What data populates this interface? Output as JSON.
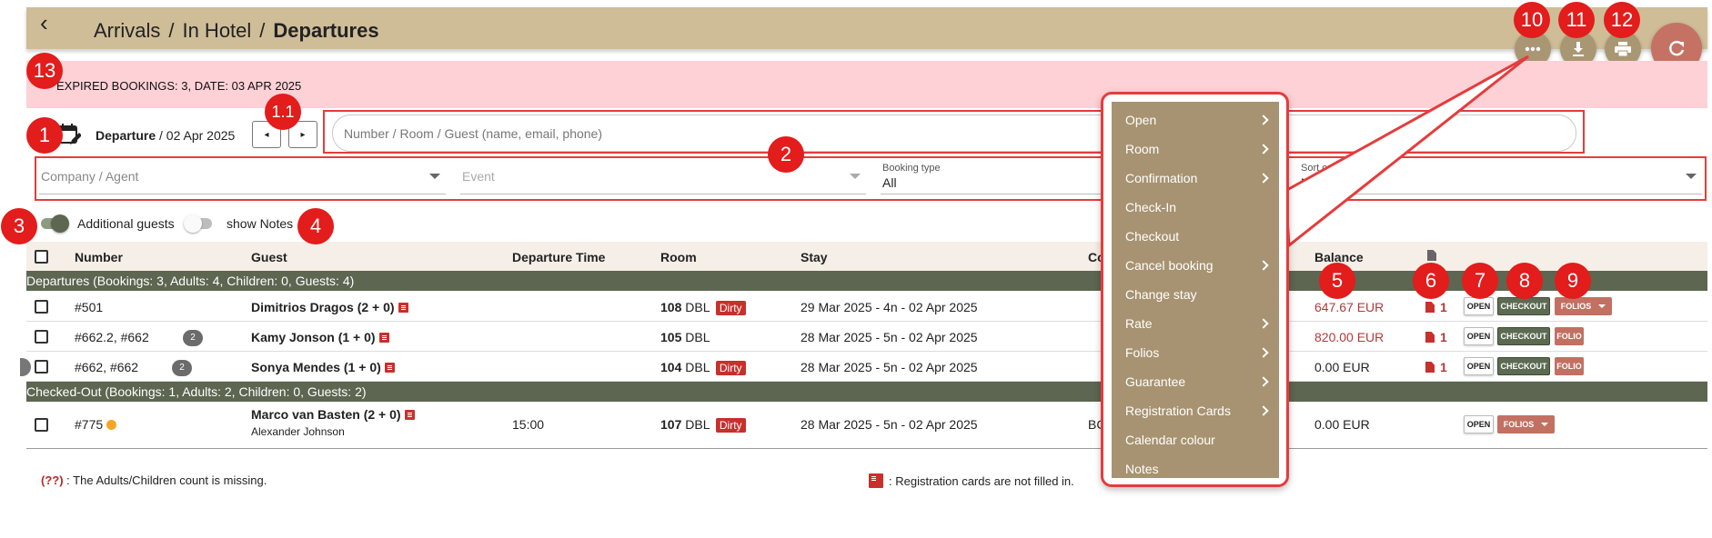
{
  "header": {
    "crumbs": [
      "Arrivals",
      "In Hotel",
      "Departures"
    ],
    "separator": "/"
  },
  "icons": {
    "back": "arrow-left-icon",
    "more": "more-horizontal-icon",
    "download": "download-icon",
    "print": "print-icon",
    "refresh": "refresh-icon",
    "calendar": "calendar-edit-icon"
  },
  "banner": {
    "text": "EXPIRED BOOKINGS: 3, DATE: 03 APR 2025"
  },
  "annotations": {
    "a1": "1",
    "a11": "1.1",
    "a2": "2",
    "a3": "3",
    "a4": "4",
    "a5": "5",
    "a6": "6",
    "a7": "7",
    "a8": "8",
    "a9": "9",
    "a10": "10",
    "a11b": "11",
    "a12": "12",
    "a13": "13"
  },
  "toolbar": {
    "date_bold": "Departure",
    "date_rest": " / 02 Apr 2025",
    "prev": "◂",
    "next": "▸",
    "search_placeholder": "Number / Room / Guest (name, email, phone)"
  },
  "filters": {
    "company": "Company / Agent",
    "event": "Event",
    "booking_type_label": "Booking type",
    "booking_type_value": "All",
    "sort_order_label": "Sort order",
    "sort_order_value": "Name"
  },
  "toggles": {
    "additional_guests": "Additional guests",
    "show_notes": "show Notes"
  },
  "table": {
    "headers": {
      "number": "Number",
      "guest": "Guest",
      "departure_time": "Departure Time",
      "room": "Room",
      "stay": "Stay",
      "company": "Co",
      "balance": "Balance"
    },
    "groups": [
      "Departures (Bookings: 3, Adults: 4, Children: 0, Guests: 4)",
      "Checked-Out (Bookings: 1, Adults: 2, Children: 0, Guests: 2)"
    ],
    "rows": [
      {
        "number": "#501",
        "badge": "",
        "guest": "Dimitrios Dragos (2 + 0)",
        "guest2": "",
        "time": "",
        "room_no": "108",
        "room_type": "DBL",
        "dirty": "Dirty",
        "stay": "29 Mar 2025 - 4n - 02 Apr 2025",
        "company": "",
        "balance": "647.67 EUR",
        "docs": "1"
      },
      {
        "number": "#662.2, #662",
        "badge": "2",
        "guest": "Kamy Jonson (1 + 0)",
        "guest2": "",
        "time": "",
        "room_no": "105",
        "room_type": "DBL",
        "dirty": "",
        "stay": "28 Mar 2025 - 5n - 02 Apr 2025",
        "company": "",
        "balance": "820.00 EUR",
        "docs": "1"
      },
      {
        "number": "#662, #662",
        "badge": "2",
        "guest": "Sonya Mendes (1 + 0)",
        "guest2": "",
        "time": "",
        "room_no": "104",
        "room_type": "DBL",
        "dirty": "Dirty",
        "stay": "28 Mar 2025 - 5n - 02 Apr 2025",
        "company": "",
        "balance": "0.00 EUR",
        "docs": "1"
      },
      {
        "number": "#775",
        "badge": "",
        "guest": "Marco van Basten (2 + 0)",
        "guest2": "Alexander Johnson",
        "time": "15:00",
        "room_no": "107",
        "room_type": "DBL",
        "dirty": "Dirty",
        "stay": "28 Mar 2025 - 5n - 02 Apr 2025",
        "company": "BC",
        "balance": "0.00 EUR",
        "docs": ""
      }
    ]
  },
  "buttons": {
    "open": "OPEN",
    "checkout": "CHECKOUT",
    "folios": "FOLIOS",
    "folio": "FOLIO"
  },
  "legend": {
    "missing_code": "(??)",
    "missing_text": " : The Adults/Children count is missing.",
    "reg_text": ": Registration cards are not filled in."
  },
  "context_menu": {
    "items": [
      {
        "label": "Open",
        "submenu": true
      },
      {
        "label": "Room",
        "submenu": true
      },
      {
        "label": "Confirmation",
        "submenu": true
      },
      {
        "label": "Check-In",
        "submenu": false
      },
      {
        "label": "Checkout",
        "submenu": false
      },
      {
        "label": "Cancel booking",
        "submenu": true
      },
      {
        "label": "Change stay",
        "submenu": false
      },
      {
        "label": "Rate",
        "submenu": true
      },
      {
        "label": "Folios",
        "submenu": true
      },
      {
        "label": "Guarantee",
        "submenu": true
      },
      {
        "label": "Registration Cards",
        "submenu": true
      },
      {
        "label": "Calendar colour",
        "submenu": false
      },
      {
        "label": "Notes",
        "submenu": false
      }
    ]
  },
  "colors": {
    "header_bg": "#cfbd98",
    "accent_red": "#e31c1c",
    "group_bg": "#5c6650",
    "menu_bg": "#a79371",
    "banner_bg": "#fdd1d6"
  }
}
